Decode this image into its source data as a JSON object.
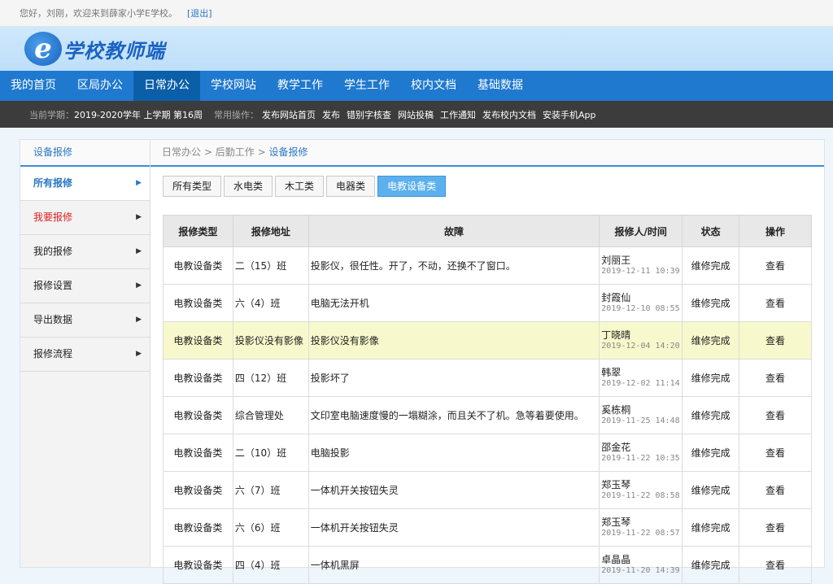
{
  "topbar": {
    "greeting": "您好，刘刚，欢迎来到薛家小学E学校。",
    "logout": "[退出]"
  },
  "logo": {
    "letter": "e",
    "title": "学校教师端"
  },
  "nav": [
    "我的首页",
    "区局办公",
    "日常办公",
    "学校网站",
    "教学工作",
    "学生工作",
    "校内文档",
    "基础数据"
  ],
  "subnav": {
    "term_label": "当前学期：",
    "term": "2019-2020学年 上学期 第16周",
    "ops_label": "常用操作：",
    "ops": [
      "发布网站首页",
      "发布",
      "错别字核查",
      "网站投稿",
      "工作通知",
      "发布校内文档",
      "安装手机App"
    ]
  },
  "sidebar": {
    "title": "设备报修",
    "items": [
      {
        "label": "所有报修",
        "arrow": "▶"
      },
      {
        "label": "我要报修",
        "arrow": "▶"
      },
      {
        "label": "我的报修",
        "arrow": "▶"
      },
      {
        "label": "报修设置",
        "arrow": "▶"
      },
      {
        "label": "导出数据",
        "arrow": "▶"
      },
      {
        "label": "报修流程",
        "arrow": "▶"
      }
    ]
  },
  "breadcrumb": {
    "p1": "日常办公",
    "p2": "后勤工作",
    "current": "设备报修",
    "sep": ">"
  },
  "tabs": [
    "所有类型",
    "水电类",
    "木工类",
    "电器类",
    "电教设备类"
  ],
  "table": {
    "headers": [
      "报修类型",
      "报修地址",
      "故障",
      "报修人/时间",
      "状态",
      "操作"
    ],
    "rows": [
      {
        "type": "电教设备类",
        "addr": "二（15）班",
        "fault": "投影仪，很任性。开了，不动，还换不了窗口。",
        "person": "刘丽王",
        "time": "2019-12-11 10:39",
        "status": "维修完成",
        "op": "查看"
      },
      {
        "type": "电教设备类",
        "addr": "六（4）班",
        "fault": "电脑无法开机",
        "person": "封霞仙",
        "time": "2019-12-10 08:55",
        "status": "维修完成",
        "op": "查看"
      },
      {
        "type": "电教设备类",
        "addr": "投影仪没有影像",
        "fault": "投影仪没有影像",
        "person": "丁晓晴",
        "time": "2019-12-04 14:20",
        "status": "维修完成",
        "op": "查看"
      },
      {
        "type": "电教设备类",
        "addr": "四（12）班",
        "fault": "投影坏了",
        "person": "韩翠",
        "time": "2019-12-02 11:14",
        "status": "维修完成",
        "op": "查看"
      },
      {
        "type": "电教设备类",
        "addr": "综合管理处",
        "fault": "文印室电脑速度慢的一塌糊涂，而且关不了机。急等着要使用。",
        "person": "奚栋桐",
        "time": "2019-11-25 14:48",
        "status": "维修完成",
        "op": "查看"
      },
      {
        "type": "电教设备类",
        "addr": "二（10）班",
        "fault": "电脑投影",
        "person": "邵金花",
        "time": "2019-11-22 10:35",
        "status": "维修完成",
        "op": "查看"
      },
      {
        "type": "电教设备类",
        "addr": "六（7）班",
        "fault": "一体机开关按钮失灵",
        "person": "郑玉琴",
        "time": "2019-11-22 08:58",
        "status": "维修完成",
        "op": "查看"
      },
      {
        "type": "电教设备类",
        "addr": "六（6）班",
        "fault": "一体机开关按钮失灵",
        "person": "郑玉琴",
        "time": "2019-11-22 08:57",
        "status": "维修完成",
        "op": "查看"
      },
      {
        "type": "电教设备类",
        "addr": "四（4）班",
        "fault": "一体机黑屏",
        "person": "卓晶晶",
        "time": "2019-11-20 14:39",
        "status": "维修完成",
        "op": "查看"
      }
    ]
  },
  "colors": {
    "nav_bg": "#1f79cf",
    "nav_active": "#0b5fa9",
    "accent": "#2a76c6",
    "tab_active": "#5cb0ee",
    "highlight_row": "#f7f9cc",
    "red_link": "#e02020"
  }
}
